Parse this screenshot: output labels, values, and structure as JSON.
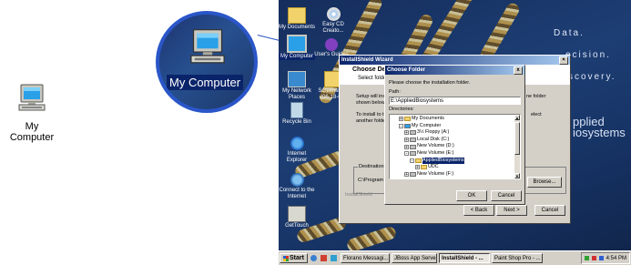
{
  "left_icon": {
    "label": "My Computer",
    "icon": "my-computer-icon"
  },
  "zoom": {
    "label": "My Computer",
    "icon": "my-computer-icon"
  },
  "desktop": {
    "brand_lines": [
      "Data.",
      "ecision.",
      "scovery."
    ],
    "brand_logo": [
      "pplied",
      "iosystems"
    ],
    "icons": [
      {
        "label": "My Documents",
        "icon": "folder-icon"
      },
      {
        "label": "Easy CD Creato...",
        "icon": "cd-icon"
      },
      {
        "label": "My Computer",
        "icon": "my-computer-icon"
      },
      {
        "label": "User's Guides",
        "icon": "help-icon"
      },
      {
        "label": "My Network Places",
        "icon": "network-icon"
      },
      {
        "label": "Screenshots (06-18-02)",
        "icon": "folder-icon"
      },
      {
        "label": "Recycle Bin",
        "icon": "recycle-bin-icon"
      },
      {
        "label": "Internet Explorer",
        "icon": "ie-icon"
      },
      {
        "label": "Connect to the Internet",
        "icon": "connect-icon"
      },
      {
        "label": "GetTouch",
        "icon": "gettouch-icon"
      }
    ]
  },
  "installshield": {
    "title": "InstallShield Wizard",
    "heading": "Choose Dest",
    "subheading": "Select folder",
    "text1": "Setup will ins shown below",
    "text2": "To install to th another folde",
    "right_text1": "ne folder",
    "right_text2": "elect",
    "dest_label": "Destination",
    "dest_value": "C:\\Program",
    "footer": "InstallShield",
    "browse_label": "Browse...",
    "cancel_label": "Cancel",
    "back_label": "< Back",
    "next_label": "Next >"
  },
  "choose_folder": {
    "title": "Choose Folder",
    "close": "x",
    "instruction": "Please choose the installation folder.",
    "path_label": "Path:",
    "path_value": "E:\\AppliedBiosystems",
    "directories_label": "Directories:",
    "tree": [
      {
        "label": "My Documents",
        "toggle": "+",
        "indent": 1,
        "icon": "folder-icon",
        "selected": false
      },
      {
        "label": "My Computer",
        "toggle": "-",
        "indent": 1,
        "icon": "my-computer-icon",
        "selected": false
      },
      {
        "label": "3½ Floppy (A:)",
        "toggle": "+",
        "indent": 2,
        "icon": "floppy-icon",
        "selected": false
      },
      {
        "label": "Local Disk (C:)",
        "toggle": "+",
        "indent": 2,
        "icon": "drive-icon",
        "selected": false
      },
      {
        "label": "New Volume (D:)",
        "toggle": "+",
        "indent": 2,
        "icon": "drive-icon",
        "selected": false
      },
      {
        "label": "New Volume (E:)",
        "toggle": "-",
        "indent": 2,
        "icon": "drive-icon",
        "selected": false
      },
      {
        "label": "AppliedBiosystems",
        "toggle": "-",
        "indent": 3,
        "icon": "folder-icon",
        "selected": true
      },
      {
        "label": "UDC",
        "toggle": "+",
        "indent": 4,
        "icon": "folder-icon",
        "selected": false
      },
      {
        "label": "New Volume (F:)",
        "toggle": "+",
        "indent": 2,
        "icon": "drive-icon",
        "selected": false
      }
    ],
    "ok_label": "OK",
    "cancel_label": "Cancel"
  },
  "taskbar": {
    "start_label": "Start",
    "tasks": [
      {
        "label": "Florano Messagi...",
        "active": false
      },
      {
        "label": "JBoss App Server",
        "active": false
      },
      {
        "label": "InstallShield - ...",
        "active": true
      },
      {
        "label": "Paint Shop Pro - ...",
        "active": false
      }
    ],
    "clock": "4:54 PM"
  },
  "colors": {
    "selection": "#0a246a",
    "circle_border": "#2a56c8",
    "desktop_bg": "#1d3e74"
  }
}
